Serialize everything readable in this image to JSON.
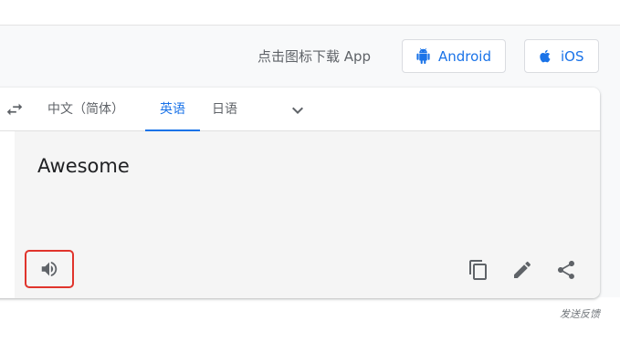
{
  "header": {
    "download_text": "点击图标下载 App",
    "android_label": "Android",
    "ios_label": "iOS",
    "android_icon": "android-icon",
    "ios_icon": "apple-icon"
  },
  "translator": {
    "swap_icon": "swap-icon",
    "tabs": [
      {
        "label": "中文（简体）",
        "active": false
      },
      {
        "label": "英语",
        "active": true
      },
      {
        "label": "日语",
        "active": false
      }
    ],
    "more_icon": "chevron-down-icon",
    "output_text": "Awesome",
    "actions": [
      "volume-icon",
      "copy-icon",
      "edit-icon",
      "share-icon"
    ]
  },
  "footer": {
    "feedback_text": "发送反馈"
  },
  "colors": {
    "accent": "#1a73e8",
    "highlight_border": "#e0342c"
  }
}
